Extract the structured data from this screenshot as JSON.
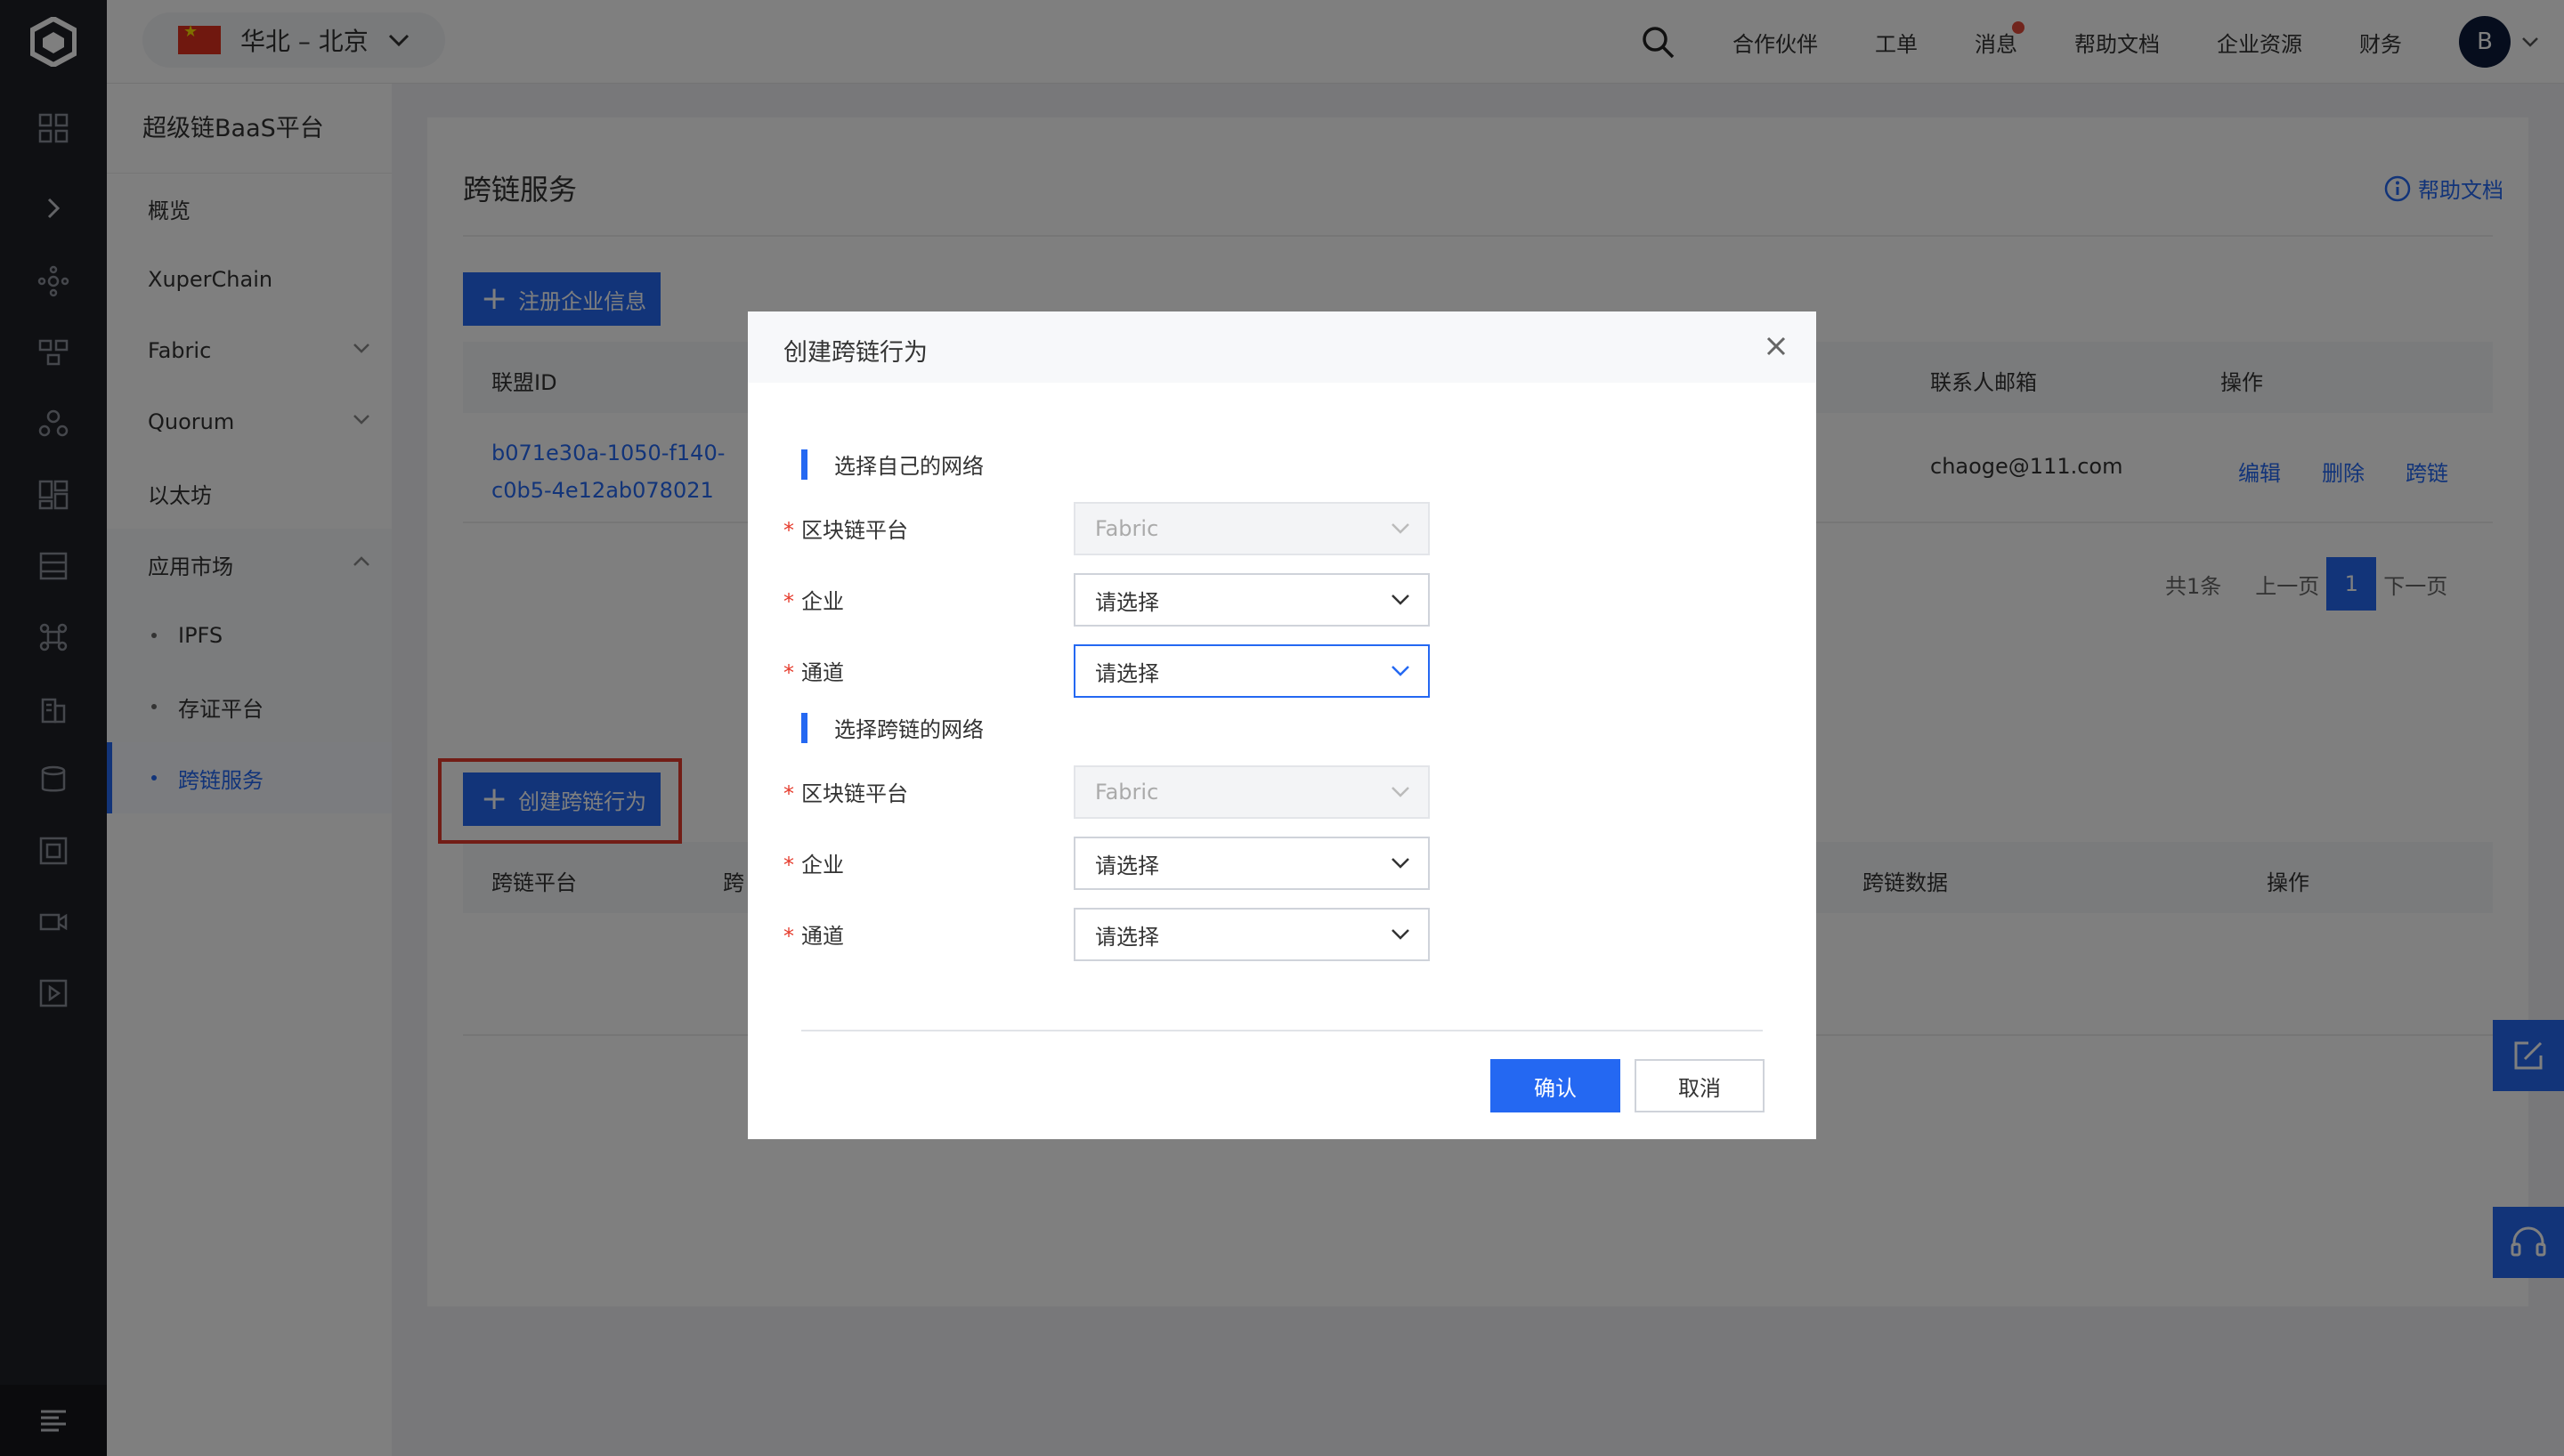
{
  "topbar": {
    "region": "华北 – 北京",
    "nav": [
      "合作伙伴",
      "工单",
      "消息",
      "帮助文档",
      "企业资源",
      "财务"
    ],
    "avatar_letter": "B"
  },
  "sidemenu": {
    "title": "超级链BaaS平台",
    "items": [
      "概览",
      "XuperChain",
      "Fabric",
      "Quorum",
      "以太坊",
      "应用市场"
    ],
    "subitems": [
      "IPFS",
      "存证平台",
      "跨链服务"
    ]
  },
  "page": {
    "title": "跨链服务",
    "help": "帮助文档",
    "register_button": "注册企业信息",
    "table1": {
      "headers": {
        "id": "联盟ID",
        "email": "联系人邮箱",
        "ops": "操作"
      },
      "row": {
        "id_line1": "b071e30a-1050-f140-",
        "id_line2": "c0b5-4e12ab078021",
        "email": "chaoge@111.com",
        "edit": "编辑",
        "delete": "删除",
        "cross": "跨链"
      }
    },
    "pager": {
      "total": "共1条",
      "prev": "上一页",
      "current": "1",
      "next": "下一页"
    },
    "create_button": "创建跨链行为",
    "table2": {
      "headers": {
        "platform": "跨链平台",
        "partial": "跨",
        "data": "跨链数据",
        "ops": "操作"
      }
    }
  },
  "modal": {
    "title": "创建跨链行为",
    "section1": "选择自己的网络",
    "section2": "选择跨链的网络",
    "labels": {
      "platform": "区块链平台",
      "company": "企业",
      "channel": "通道"
    },
    "required_mark": "*",
    "fabric": "Fabric",
    "placeholder": "请选择",
    "ok": "确认",
    "cancel": "取消"
  },
  "colors": {
    "accent": "#2468f2",
    "highlight": "#e53b2c",
    "rail": "#1e2026"
  }
}
